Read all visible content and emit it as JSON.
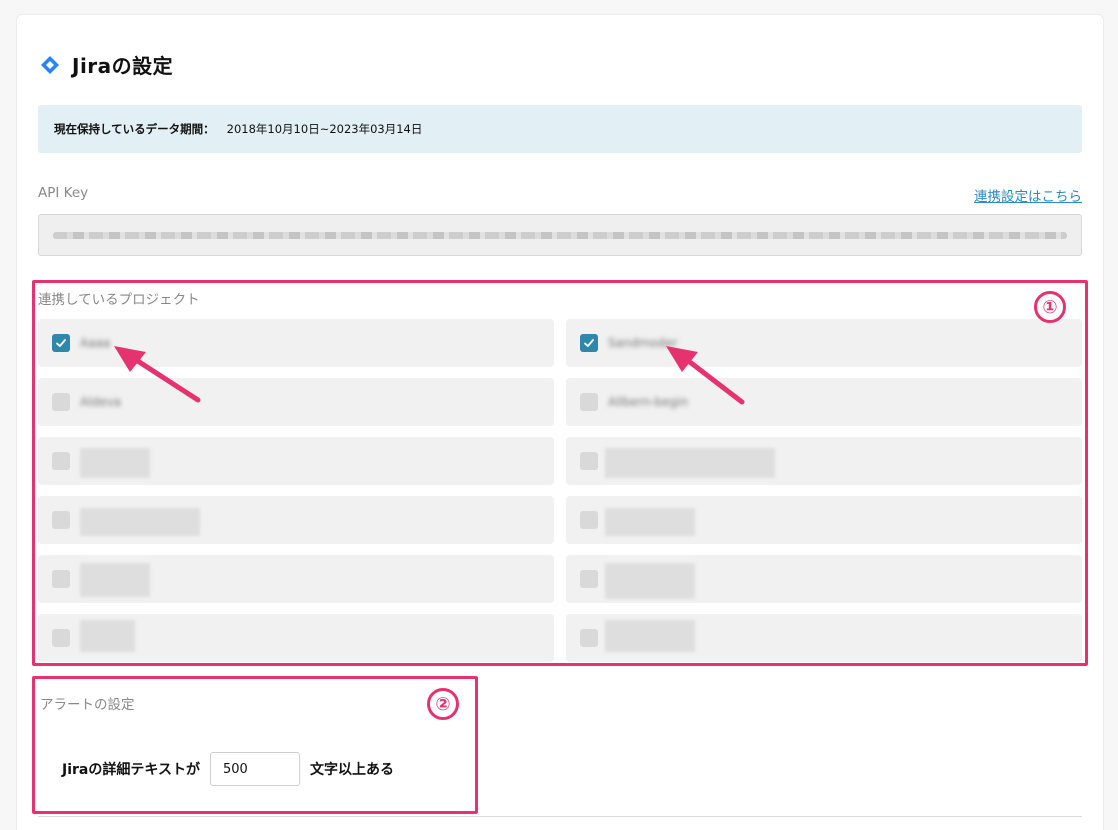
{
  "header": {
    "title": "Jiraの設定",
    "icon": "jira-diamond-icon",
    "icon_color": "#2684ff"
  },
  "retention": {
    "label": "現在保持しているデータ期間：",
    "value": "2018年10月10日~2023年03月14日"
  },
  "api": {
    "label": "API Key",
    "link_label": "連携設定はこちら"
  },
  "projects": {
    "label": "連携しているプロジェクト",
    "badge": "①",
    "items": [
      {
        "name": "Aaaa",
        "checked": true
      },
      {
        "name": "Sandmoder",
        "checked": true
      },
      {
        "name": "Aldeva",
        "checked": false
      },
      {
        "name": "Allbern-begin",
        "checked": false
      },
      {
        "name": "",
        "checked": false
      },
      {
        "name": "",
        "checked": false
      },
      {
        "name": "",
        "checked": false
      },
      {
        "name": "",
        "checked": false
      },
      {
        "name": "",
        "checked": false
      },
      {
        "name": "",
        "checked": false
      },
      {
        "name": "",
        "checked": false
      },
      {
        "name": "",
        "checked": false
      }
    ]
  },
  "alert": {
    "label": "アラートの設定",
    "badge": "②",
    "prefix": "Jiraの詳細テキストが",
    "value": "500",
    "suffix": "文字以上ある"
  },
  "colors": {
    "accent": "#2c8bc0",
    "highlight": "#e6336f",
    "checkbox": "#2f87aa",
    "info_bg": "#e2eff5"
  }
}
